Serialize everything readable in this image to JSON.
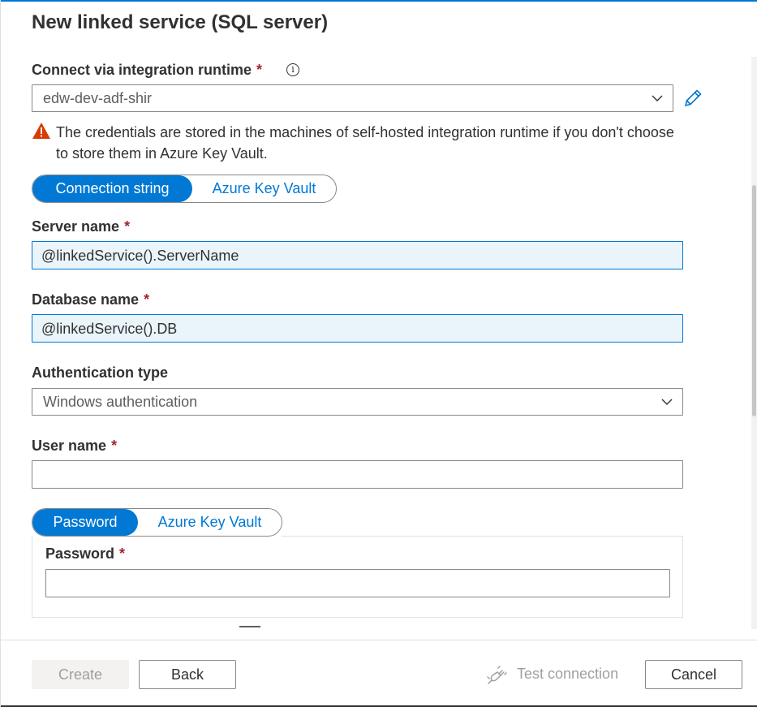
{
  "dialog": {
    "title": "New linked service (SQL server)"
  },
  "integration_runtime": {
    "label": "Connect via integration runtime",
    "required_mark": "*",
    "info_icon": "info-icon",
    "selected": "edw-dev-adf-shir",
    "edit_icon": "pencil-icon"
  },
  "warning": {
    "icon": "warning-triangle-icon",
    "text": "The credentials are stored in the machines of self-hosted integration runtime if you don't choose to store them in Azure Key Vault."
  },
  "connection_toggle": {
    "options": [
      "Connection string",
      "Azure Key Vault"
    ],
    "selected": "Connection string"
  },
  "server_name": {
    "label": "Server name",
    "required_mark": "*",
    "value": "@linkedService().ServerName"
  },
  "database_name": {
    "label": "Database name",
    "required_mark": "*",
    "value": "@linkedService().DB"
  },
  "auth_type": {
    "label": "Authentication type",
    "selected": "Windows authentication"
  },
  "user_name": {
    "label": "User name",
    "required_mark": "*",
    "value": ""
  },
  "password_toggle": {
    "options": [
      "Password",
      "Azure Key Vault"
    ],
    "selected": "Password"
  },
  "password": {
    "label": "Password",
    "required_mark": "*",
    "value": ""
  },
  "footer": {
    "create_label": "Create",
    "back_label": "Back",
    "test_connection_label": "Test connection",
    "test_connection_icon": "plug-icon",
    "cancel_label": "Cancel"
  },
  "colors": {
    "accent": "#0078d4",
    "required": "#a4262c",
    "warning": "#d83b01",
    "disabled_text": "#a19f9d"
  }
}
